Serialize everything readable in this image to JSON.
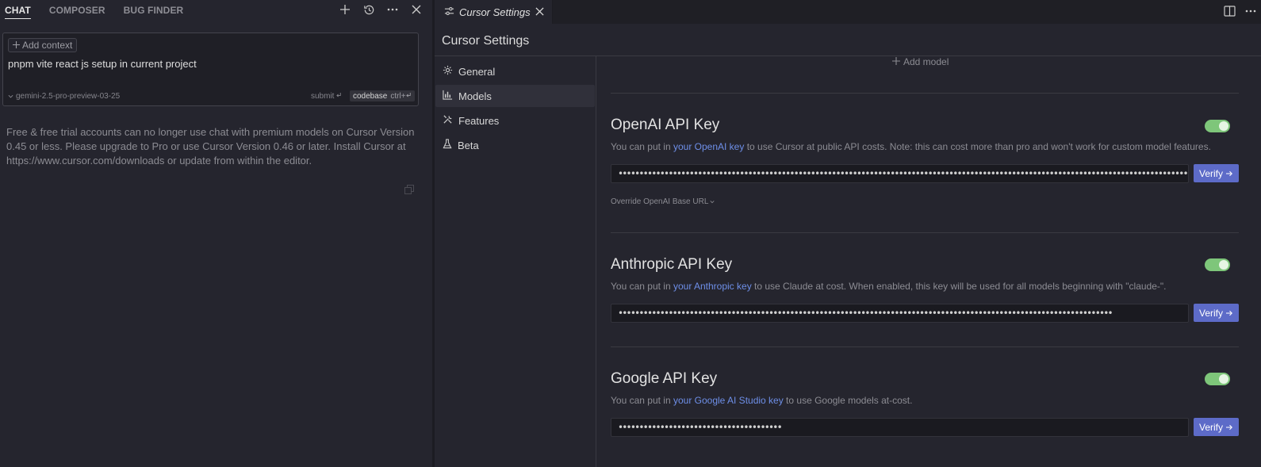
{
  "chat_panel": {
    "tabs": [
      {
        "label": "CHAT",
        "active": true
      },
      {
        "label": "COMPOSER",
        "active": false
      },
      {
        "label": "BUG FINDER",
        "active": false
      }
    ],
    "header_icons": [
      "plus-icon",
      "history-icon",
      "more-icon",
      "close-icon"
    ],
    "add_context_label": "Add context",
    "prompt_text": "pnpm vite react js setup in current project",
    "model_label": "gemini-2.5-pro-preview-03-25",
    "submit_label": "submit",
    "codebase_label": "codebase",
    "codebase_shortcut": "ctrl+",
    "notice": "Free & free trial accounts can no longer use chat with premium models on Cursor Version 0.45 or less. Please upgrade to Pro or use Cursor Version 0.46 or later. Install Cursor at https://www.cursor.com/downloads or update from within the editor."
  },
  "settings": {
    "tab_title": "Cursor Settings",
    "page_title": "Cursor Settings",
    "nav": [
      {
        "label": "General",
        "icon": "gear-icon",
        "active": false
      },
      {
        "label": "Models",
        "icon": "chart-icon",
        "active": true
      },
      {
        "label": "Features",
        "icon": "tools-icon",
        "active": false
      },
      {
        "label": "Beta",
        "icon": "flask-icon",
        "active": false
      }
    ],
    "add_model_label": "Add model",
    "verify_label": "Verify",
    "sections": {
      "openai": {
        "title": "OpenAI API Key",
        "desc_before": "You can put in ",
        "desc_link": "your OpenAI key",
        "desc_after": " to use Cursor at public API costs. Note: this can cost more than pro and won't work for custom model features.",
        "key_value": "••••••••••••••••••••••••••••••••••••••••••••••••••••••••••••••••••••••••••••••••••••••••••••••••••••••••••••••••••••••••••••••••••••••••••••••••••••••••••••••••••••••",
        "enabled": true,
        "override_label": "Override OpenAI Base URL"
      },
      "anthropic": {
        "title": "Anthropic API Key",
        "desc_before": "You can put in ",
        "desc_link": "your Anthropic key",
        "desc_after": " to use Claude at cost. When enabled, this key will be used for all models beginning with \"claude-\".",
        "key_value": "••••••••••••••••••••••••••••••••••••••••••••••••••••••••••••••••••••••••••••••••••••••••••••••••••••••••••••••••••••••",
        "enabled": true
      },
      "google": {
        "title": "Google API Key",
        "desc_before": "You can put in ",
        "desc_link": "your Google AI Studio key",
        "desc_after": " to use Google models at-cost.",
        "key_value": "•••••••••••••••••••••••••••••••••••••••",
        "enabled": true
      }
    },
    "colors": {
      "accent": "#5d6bc8",
      "link": "#6e8fe8",
      "toggle_on": "#7ec67a"
    }
  }
}
